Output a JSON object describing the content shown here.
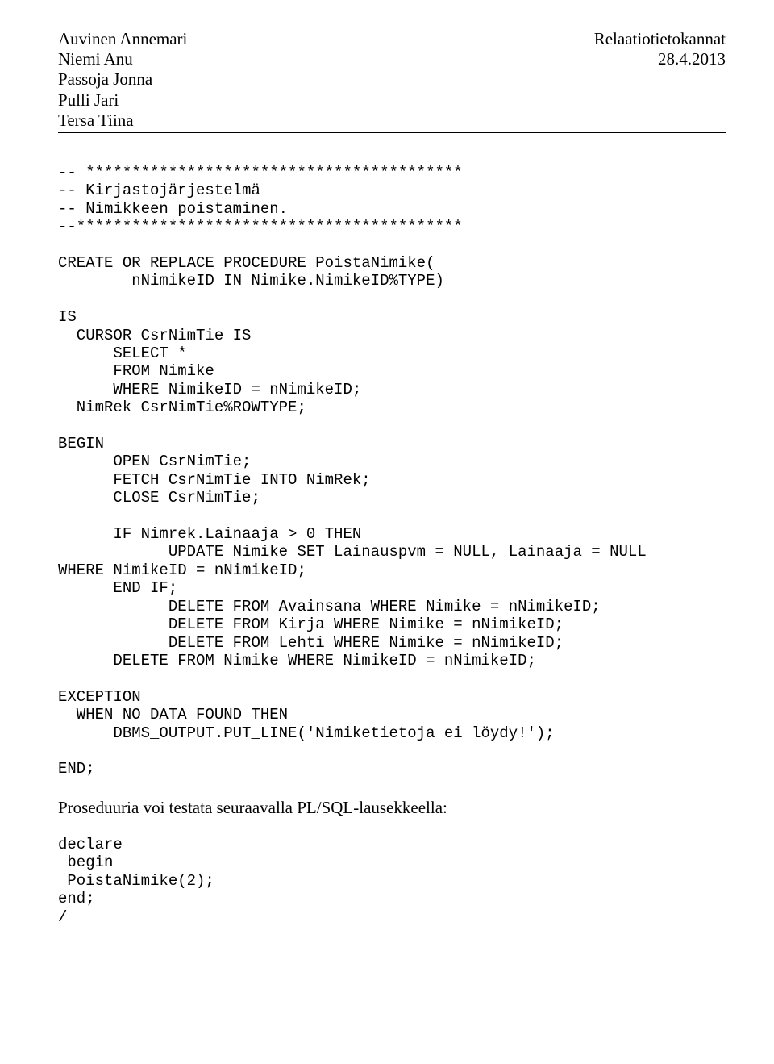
{
  "header": {
    "authors": [
      "Auvinen Annemari",
      "Niemi Anu",
      "Passoja Jonna",
      "Pulli Jari",
      "Tersa Tiina"
    ],
    "course": "Relaatiotietokannat",
    "date": "28.4.2013"
  },
  "code_block": "-- *****************************************\n-- Kirjastojärjestelmä\n-- Nimikkeen poistaminen.\n--******************************************\n\nCREATE OR REPLACE PROCEDURE PoistaNimike(\n        nNimikeID IN Nimike.NimikeID%TYPE)\n\nIS\n  CURSOR CsrNimTie IS\n      SELECT *\n      FROM Nimike\n      WHERE NimikeID = nNimikeID;\n  NimRek CsrNimTie%ROWTYPE;\n\nBEGIN\n      OPEN CsrNimTie;\n      FETCH CsrNimTie INTO NimRek;\n      CLOSE CsrNimTie;\n\n      IF Nimrek.Lainaaja > 0 THEN\n            UPDATE Nimike SET Lainauspvm = NULL, Lainaaja = NULL\nWHERE NimikeID = nNimikeID;\n      END IF;\n            DELETE FROM Avainsana WHERE Nimike = nNimikeID;\n            DELETE FROM Kirja WHERE Nimike = nNimikeID;\n            DELETE FROM Lehti WHERE Nimike = nNimikeID;\n      DELETE FROM Nimike WHERE NimikeID = nNimikeID;\n\nEXCEPTION\n  WHEN NO_DATA_FOUND THEN\n      DBMS_OUTPUT.PUT_LINE('Nimiketietoja ei löydy!');\n\nEND;",
  "body_text": "Proseduuria voi testata seuraavalla PL/SQL-lausekkeella:",
  "code_block2": "declare\n begin\n PoistaNimike(2);\nend;\n/"
}
